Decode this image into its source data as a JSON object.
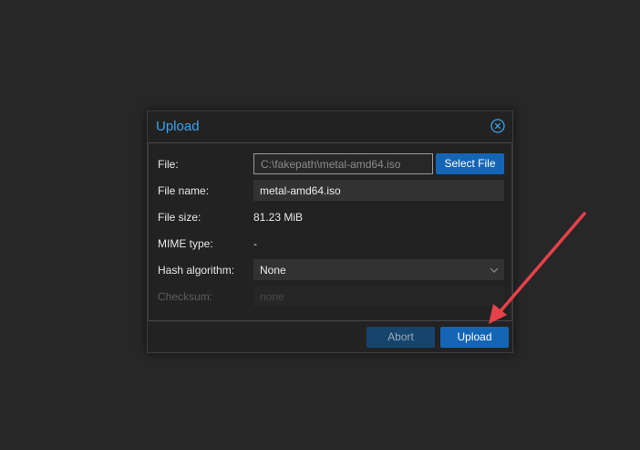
{
  "dialog": {
    "title": "Upload",
    "fields": {
      "file_label": "File:",
      "file_value": "C:\\fakepath\\metal-amd64.iso",
      "select_file_label": "Select File",
      "file_name_label": "File name:",
      "file_name_value": "metal-amd64.iso",
      "file_size_label": "File size:",
      "file_size_value": "81.23 MiB",
      "mime_type_label": "MIME type:",
      "mime_type_value": "-",
      "hash_algorithm_label": "Hash algorithm:",
      "hash_algorithm_value": "None",
      "checksum_label": "Checksum:",
      "checksum_placeholder": "none"
    },
    "footer": {
      "abort_label": "Abort",
      "upload_label": "Upload"
    }
  },
  "colors": {
    "accent": "#1565b5",
    "title": "#3ea3e8",
    "annotation_arrow": "#e8414a"
  },
  "icons": {
    "close": "close-circle-icon",
    "dropdown": "chevron-down-icon"
  }
}
